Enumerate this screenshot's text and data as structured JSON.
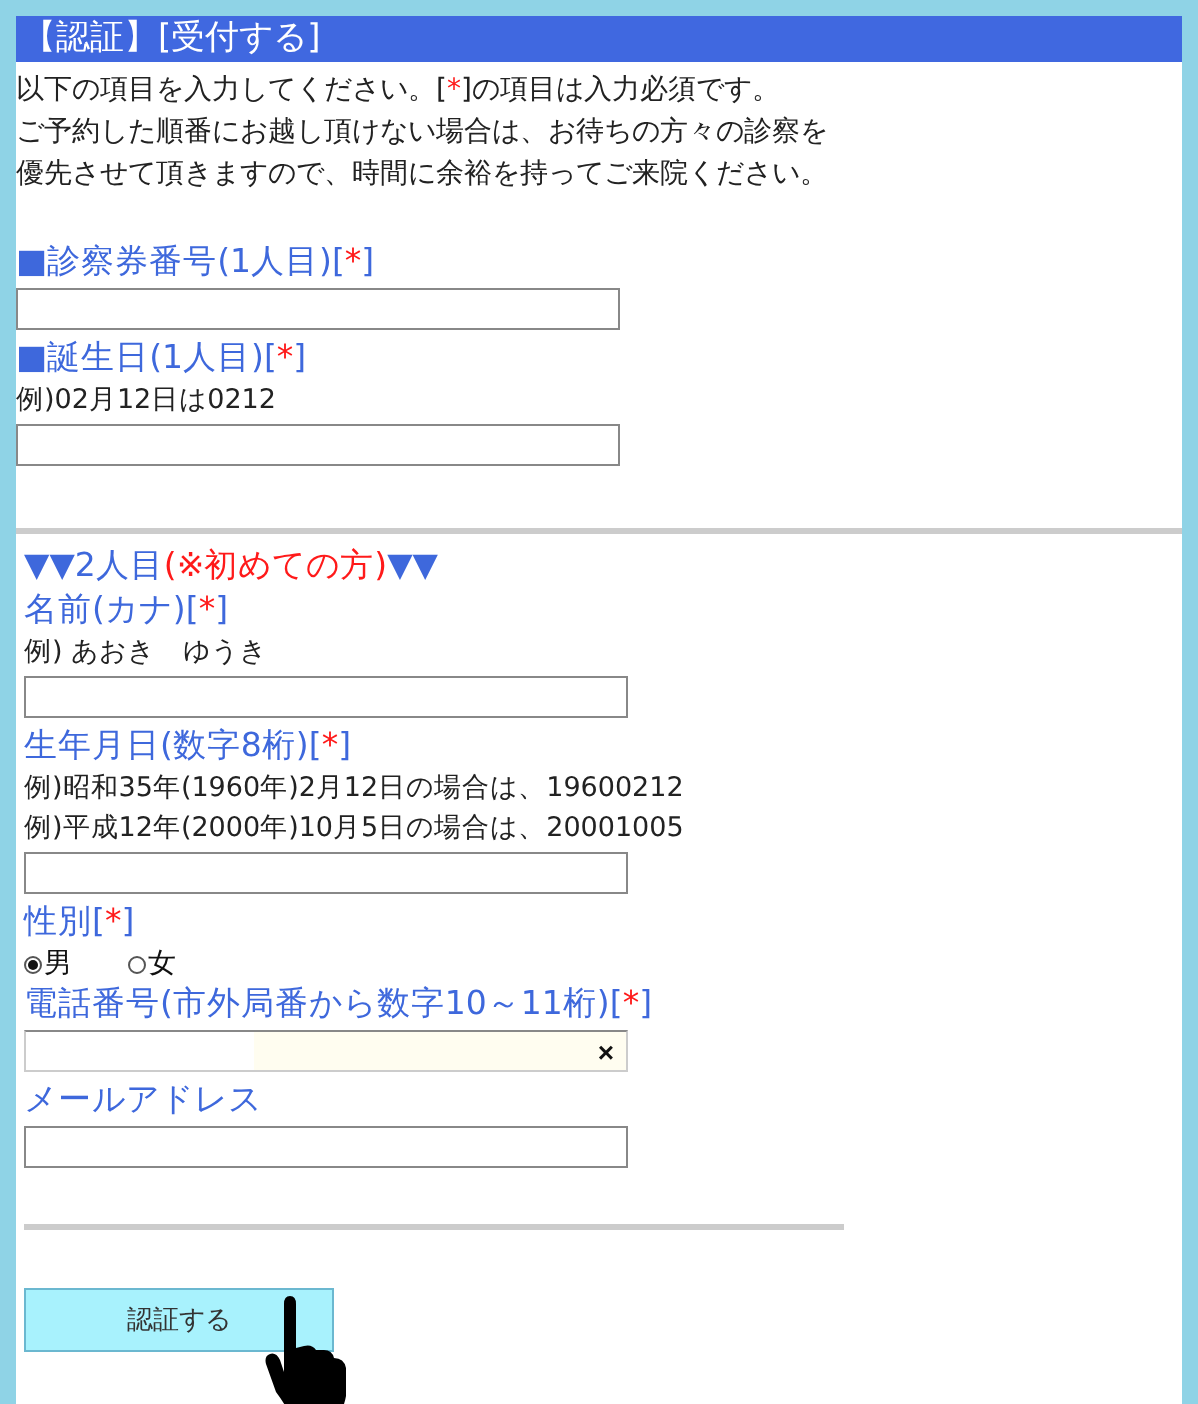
{
  "header": {
    "title": "【認証】[受付する]"
  },
  "intro": [
    [
      {
        "kind": "plain",
        "text": "以下の項目を入力してください。["
      },
      {
        "kind": "required",
        "text": "*"
      },
      {
        "kind": "plain",
        "text": "]の項目は入力必須です。"
      }
    ],
    [
      {
        "kind": "plain",
        "text": "ご予約した順番にお越し頂けない場合は、お待ちの方々の診察を"
      }
    ],
    [
      {
        "kind": "plain",
        "text": "優先させて頂きますので、時間に余裕を持ってご来院ください。"
      }
    ]
  ],
  "section_1": {
    "fields": [
      {
        "kind": "text",
        "label": [
          {
            "kind": "accent",
            "text": "■診察券番号(1人目)["
          },
          {
            "kind": "required",
            "text": "*"
          },
          {
            "kind": "accent",
            "text": "]"
          }
        ]
      },
      {
        "kind": "text",
        "label": [
          {
            "kind": "accent",
            "text": "■誕生日(1人目)["
          },
          {
            "kind": "required",
            "text": "*"
          },
          {
            "kind": "accent",
            "text": "]"
          }
        ],
        "hints": [
          "例)02月12日は0212"
        ]
      }
    ]
  },
  "section_2": {
    "heading": [
      {
        "kind": "accent",
        "text": "▼▼2人目"
      },
      {
        "kind": "warning",
        "text": "(※初めての方)"
      },
      {
        "kind": "accent",
        "text": "▼▼"
      }
    ],
    "fields": [
      {
        "kind": "text",
        "label": [
          {
            "kind": "accent",
            "text": "名前(カナ)["
          },
          {
            "kind": "required",
            "text": "*"
          },
          {
            "kind": "accent",
            "text": "]"
          }
        ],
        "hints": [
          "例) あおき　ゆうき"
        ]
      },
      {
        "kind": "text",
        "label": [
          {
            "kind": "accent",
            "text": "生年月日(数字8桁)["
          },
          {
            "kind": "required",
            "text": "*"
          },
          {
            "kind": "accent",
            "text": "]"
          }
        ],
        "hints": [
          "例)昭和35年(1960年)2月12日の場合は、19600212",
          "例)平成12年(2000年)10月5日の場合は、20001005"
        ]
      },
      {
        "kind": "radio",
        "label": [
          {
            "kind": "accent",
            "text": "性別["
          },
          {
            "kind": "required",
            "text": "*"
          },
          {
            "kind": "accent",
            "text": "]"
          }
        ],
        "options": [
          {
            "label": "男",
            "selected": true
          },
          {
            "label": "女",
            "selected": false
          }
        ]
      },
      {
        "kind": "text",
        "label": [
          {
            "kind": "accent",
            "text": "電話番号(市外局番から数字10～11桁)["
          },
          {
            "kind": "required",
            "text": "*"
          },
          {
            "kind": "accent",
            "text": "]"
          }
        ],
        "autofilled": true,
        "clear_button": "×"
      },
      {
        "kind": "text",
        "label": [
          {
            "kind": "accent",
            "text": "メールアドレス"
          }
        ]
      }
    ]
  },
  "submit_button": "認証する"
}
